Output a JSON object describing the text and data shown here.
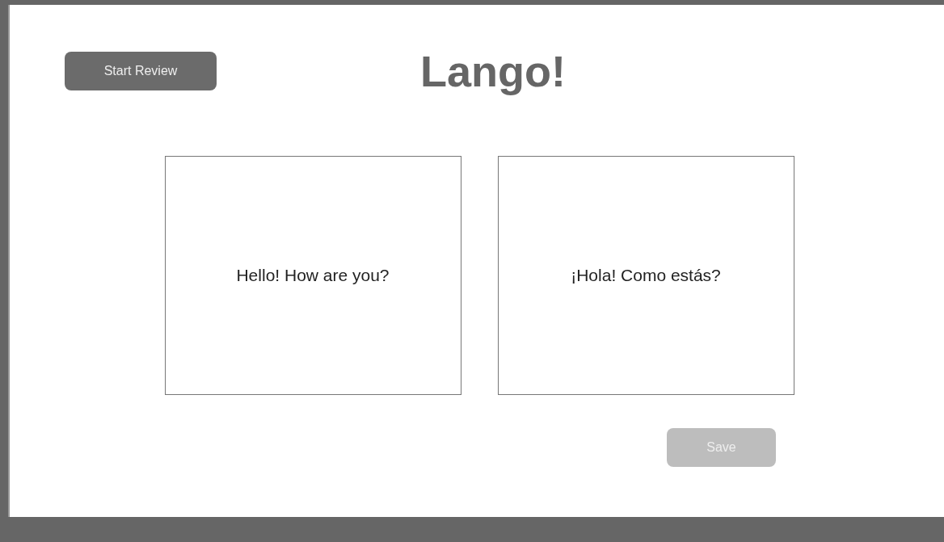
{
  "header": {
    "review_button": {
      "label": "Start Review"
    },
    "title": "Lango!"
  },
  "cards": [
    {
      "text": "Hello! How are you?"
    },
    {
      "text": "¡Hola! Como estás?"
    }
  ],
  "save_button": {
    "label": "Save",
    "disabled": true
  }
}
